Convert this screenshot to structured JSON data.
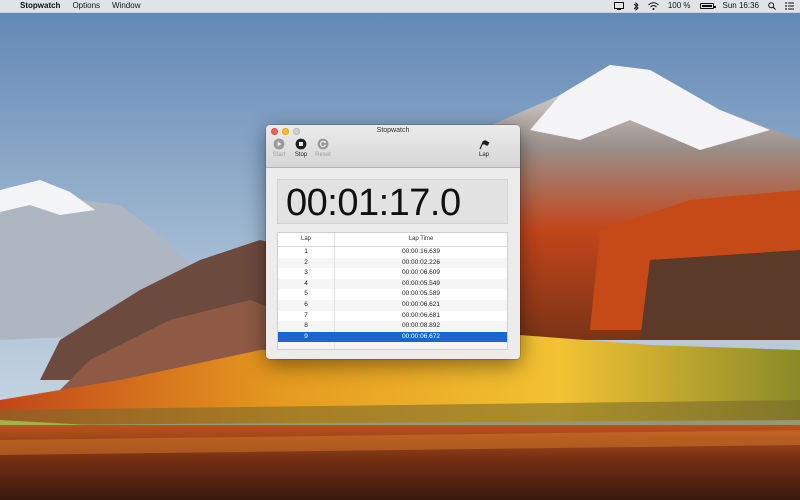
{
  "menubar": {
    "app_name": "Stopwatch",
    "menus": [
      "Options",
      "Window"
    ],
    "battery_text": "100 %",
    "clock": "Sun 16:36"
  },
  "window": {
    "title": "Stopwatch",
    "toolbar": {
      "start_label": "Start",
      "stop_label": "Stop",
      "reset_label": "Reset",
      "lap_label": "Lap"
    },
    "time_display": "00:01:17.0",
    "table": {
      "columns": [
        "Lap",
        "Lap Time"
      ],
      "rows": [
        {
          "lap": "1",
          "time": "00:00:16.639"
        },
        {
          "lap": "2",
          "time": "00:00:02.226"
        },
        {
          "lap": "3",
          "time": "00:00:06.609"
        },
        {
          "lap": "4",
          "time": "00:00:05.549"
        },
        {
          "lap": "5",
          "time": "00:00:05.589"
        },
        {
          "lap": "6",
          "time": "00:00:06.621"
        },
        {
          "lap": "7",
          "time": "00:00:06.681"
        },
        {
          "lap": "8",
          "time": "00:00:08.892"
        },
        {
          "lap": "9",
          "time": "00:00:06.672"
        }
      ],
      "selected_lap": "9"
    }
  },
  "colors": {
    "selection": "#1a65d2",
    "close": "#fc5f57",
    "minimize": "#fdbc2e"
  }
}
